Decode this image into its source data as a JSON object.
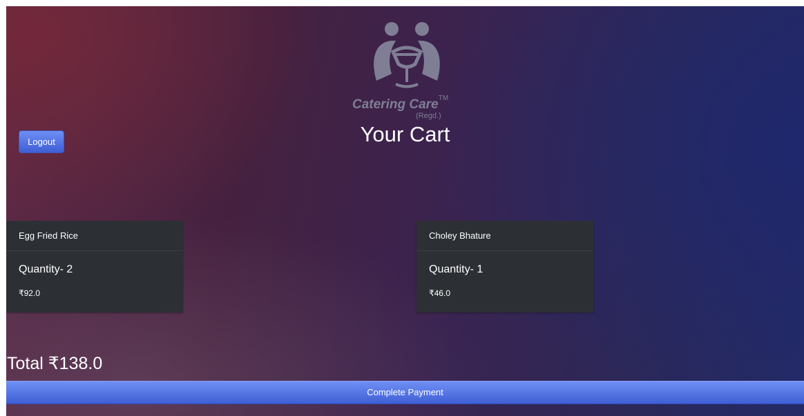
{
  "header": {
    "brand_name": "Catering Care",
    "brand_trademark": "TM",
    "brand_registered": "(Regd.)",
    "title": "Your Cart",
    "logout_label": "Logout"
  },
  "cart": {
    "items": [
      {
        "name": "Egg Fried Rice",
        "quantity": "Quantity- 2",
        "price": "₹92.0"
      },
      {
        "name": "Choley Bhature",
        "quantity": "Quantity- 1",
        "price": "₹46.0"
      }
    ],
    "total": "Total ₹138.0",
    "pay_label": "Complete Payment"
  },
  "colors": {
    "accent": "#4f6fe6",
    "card_bg": "#2c3035",
    "logo": "#7f7e94"
  },
  "icons": {
    "logo": "catering-care-logo-icon"
  }
}
